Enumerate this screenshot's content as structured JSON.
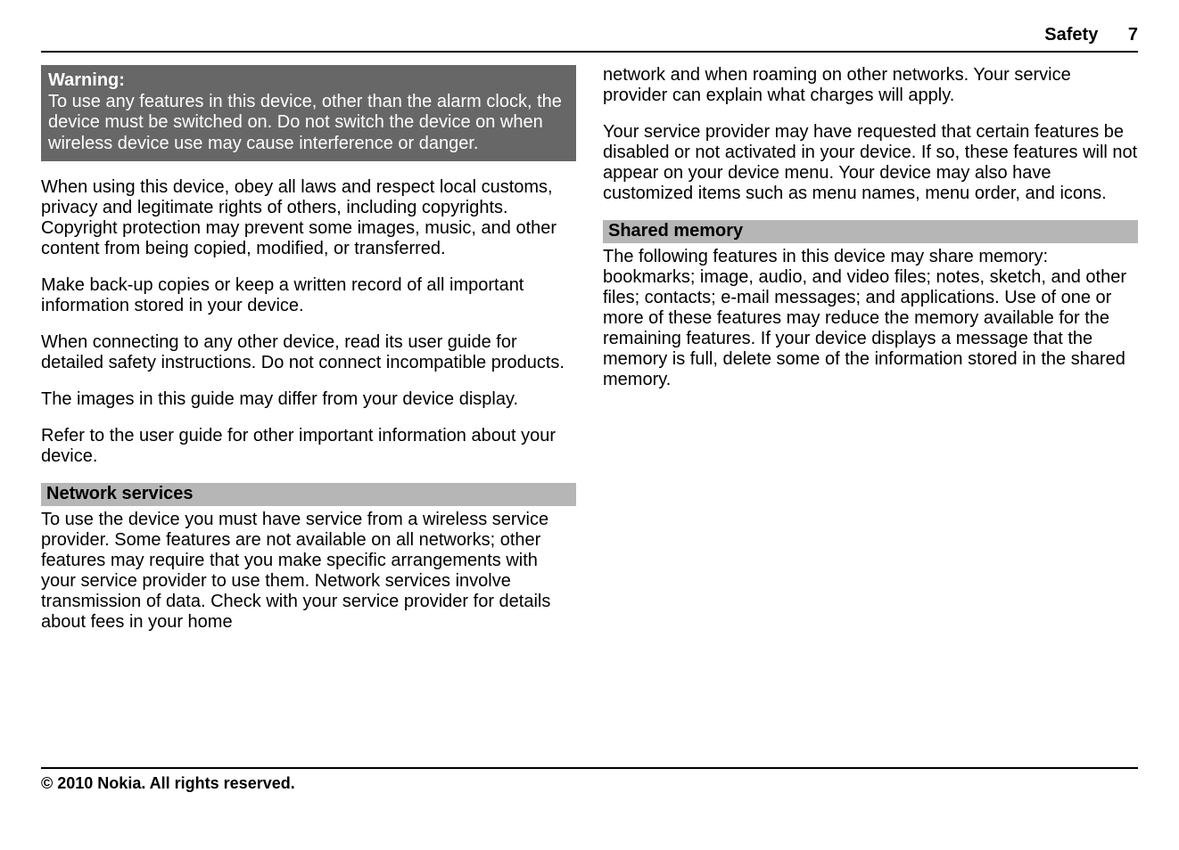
{
  "header": {
    "section": "Safety",
    "page": "7"
  },
  "col1": {
    "warning": {
      "title": "Warning:",
      "body": "To use any features in this device, other than the alarm clock, the device must be switched on. Do not switch the device on when wireless device use may cause interference or danger."
    },
    "p1": "When using this device, obey all laws and respect local customs, privacy and legitimate rights of others, including copyrights. Copyright protection may prevent some images, music, and other content from being copied, modified, or transferred.",
    "p2": "Make back-up copies or keep a written record of all important information stored in your device.",
    "p3": "When connecting to any other device, read its user guide for detailed safety instructions. Do not connect incompatible products.",
    "p4": "The images in this guide may differ from your device display.",
    "p5": "Refer to the user guide for other important information about your device.",
    "section1": {
      "title": "Network services",
      "body": "To use the device you must have service from a wireless service provider. Some features are not available on all networks; other features may require that you make specific arrangements with your service provider to use them. Network services involve transmission of data. Check with your service provider for details about fees in your home"
    }
  },
  "col2": {
    "p1": "network and when roaming on other networks. Your service provider can explain what charges will apply.",
    "p2": "Your service provider may have requested that certain features be disabled or not activated in your device. If so, these features will not appear on your device menu. Your device may also have customized items such as menu names, menu order, and icons.",
    "section1": {
      "title": "Shared memory",
      "body": "The following features in this device may share memory: bookmarks; image, audio, and video files; notes, sketch, and other files; contacts; e-mail messages; and applications. Use of one or more of these features may reduce the memory available for the remaining features. If your device displays a message that the memory is full, delete some of the information stored in the shared memory."
    }
  },
  "footer": "© 2010 Nokia. All rights reserved."
}
